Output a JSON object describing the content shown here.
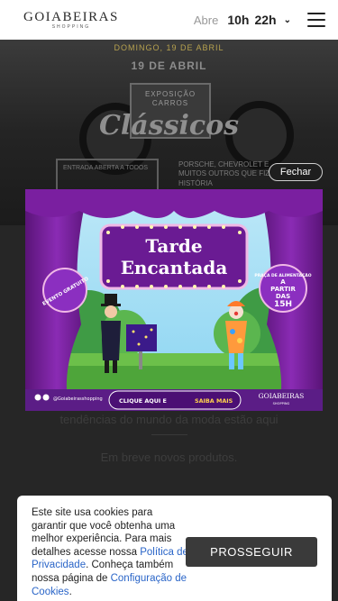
{
  "header": {
    "logo_main": "GOIABEIRAS",
    "logo_sub": "SHOPPING",
    "hours_label": "Abre",
    "open_time": "10h",
    "close_time": "22h"
  },
  "hero": {
    "top_line": "DOMINGO, 19 DE ABRIL",
    "date": "19 DE ABRIL",
    "badge": "EXPOSIÇÃO CARROS",
    "title": "Clássicos",
    "entry": "ENTRADA ABERTA A TODOS",
    "info": "PORSCHE, CHEVROLET E MUITOS OUTROS QUE FIZERAM HISTÓRIA"
  },
  "modal": {
    "close_label": "Fechar"
  },
  "popup": {
    "title_line1": "Tarde",
    "title_line2": "Encantada",
    "left_badge": "EVENTO GRATUITO",
    "right_badge_top": "PRAÇA DE ALIMENTAÇÃO",
    "right_badge_a": "A",
    "right_badge_b": "PARTIR",
    "right_badge_c": "DAS",
    "right_badge_d": "15H",
    "social_handle": "@Goiabeirasshopping",
    "cta_part1": "CLIQUE AQUI E",
    "cta_part2": "SAIBA MAIS",
    "brand_main": "GOIABEIRAS",
    "brand_sub": "SHOPPING",
    "colors": {
      "curtain": "#7a1fa0",
      "frame": "#f0b8e6",
      "sky": "#8fd6f2",
      "grass": "#6cc04a",
      "cta_bg": "#5b1d86",
      "cta_accent": "#ffd34d"
    }
  },
  "content": {
    "tagline": "tendências do mundo da moda estão aqui",
    "soon": "Em breve novos produtos."
  },
  "cookie": {
    "text_1": "Este site usa cookies para garantir que você obtenha uma melhor experiência. Para mais detalhes acesse nossa ",
    "privacy_link": "Política de Privacidade",
    "text_2": ". Conheça também nossa página de ",
    "config_link": "Configuração de Cookies",
    "text_3": ".",
    "accept_label": "PROSSEGUIR"
  }
}
